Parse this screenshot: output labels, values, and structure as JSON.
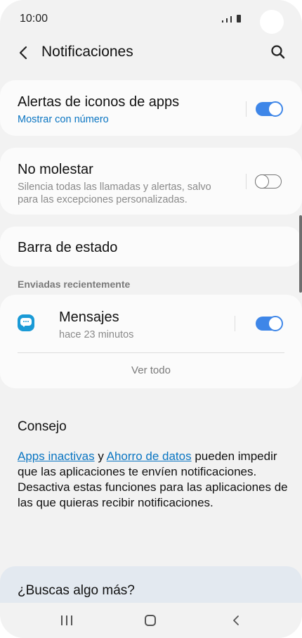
{
  "status_bar": {
    "time": "10:00"
  },
  "header": {
    "title": "Notificaciones"
  },
  "badges_card": {
    "title": "Alertas de iconos de apps",
    "subtitle": "Mostrar con número",
    "toggle_on": true
  },
  "dnd_card": {
    "title": "No molestar",
    "subtitle_line1": "Silencia todas las llamadas y alertas, salvo",
    "subtitle_line2": "para las excepciones personalizadas.",
    "toggle_on": false
  },
  "status_bar_setting": {
    "title": "Barra de estado"
  },
  "recent": {
    "section_label": "Enviadas recientemente",
    "app_name": "Mensajes",
    "app_time": "hace 23 minutos",
    "toggle_on": true,
    "see_all": "Ver todo"
  },
  "tip": {
    "title": "Consejo",
    "link1": "Apps inactivas",
    "connector": " y ",
    "link2": "Ahorro de datos",
    "rest": " pueden impedir que las aplicaciones te envíen notificaciones. Desactiva estas funciones para las aplicaciones de las que quieras recibir notificaciones."
  },
  "more": {
    "label": "¿Buscas algo más?"
  },
  "colors": {
    "accent": "#3e86e8",
    "link": "#0a75c2",
    "background": "#f2f2f2"
  }
}
